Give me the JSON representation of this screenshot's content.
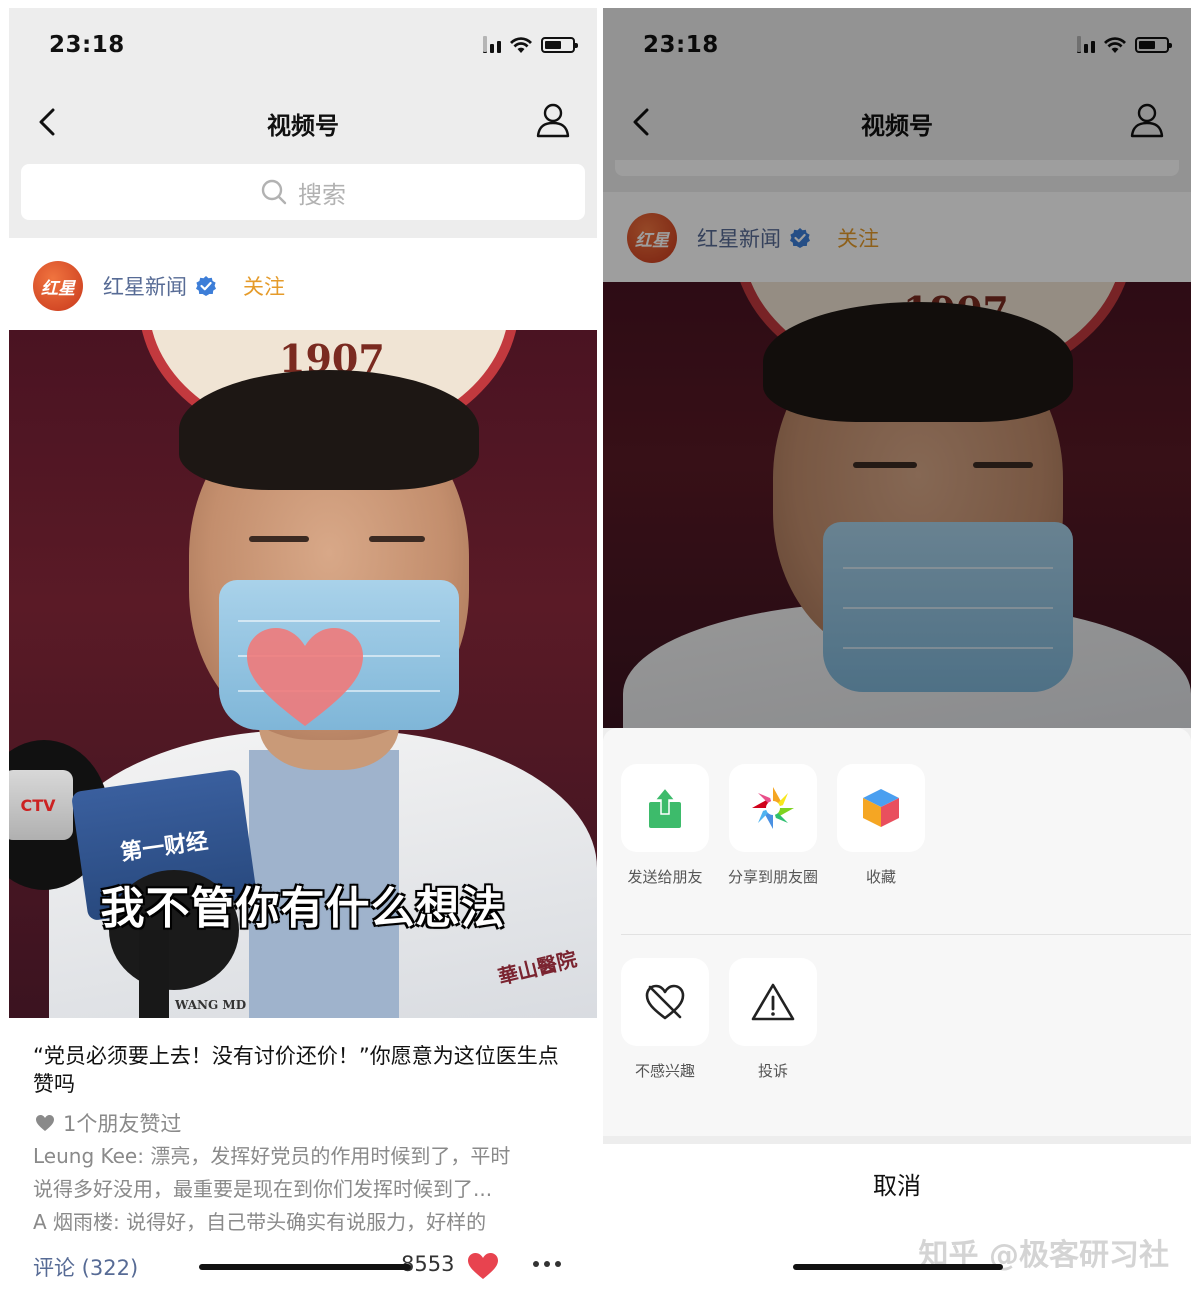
{
  "status": {
    "time": "23:18"
  },
  "nav": {
    "title": "视频号"
  },
  "search": {
    "placeholder": "搜索"
  },
  "author": {
    "avatar_text": "红星",
    "name": "红星新闻",
    "follow": "关注"
  },
  "video": {
    "emblem_year": "1907",
    "mic_logo": "第一财经",
    "mic_left": "CTV",
    "badge": "華山醫院",
    "name_tag": "WANG MD",
    "caption": "我不管你有什么想法"
  },
  "post": {
    "title": "“党员必须要上去！没有讨价还价！”你愿意为这位医生点赞吗",
    "friends_liked": "1个朋友赞过",
    "comments": [
      "Leung Kee: 漂亮，发挥好党员的作用时候到了，平时",
      "说得多好没用，最重要是现在到你们发挥时候到了...",
      "A 烟雨楼: 说得好，自己带头确实有说服力，好样的"
    ],
    "comments_link": "评论 (322)",
    "like_count": "8553"
  },
  "share_sheet": {
    "row1": [
      {
        "label": "发送给朋友",
        "icon": "share-arrow-icon"
      },
      {
        "label": "分享到朋友圈",
        "icon": "moments-aperture-icon"
      },
      {
        "label": "收藏",
        "icon": "favorite-cube-icon"
      }
    ],
    "row2": [
      {
        "label": "不感兴趣",
        "icon": "not-interested-heart-icon"
      },
      {
        "label": "投诉",
        "icon": "warning-triangle-icon"
      }
    ],
    "cancel": "取消"
  },
  "watermark": "知乎 @极客研习社",
  "colors": {
    "link": "#576b95",
    "follow": "#e59b2a",
    "like_red": "#e8434f",
    "share_green": "#3dbb6b"
  }
}
